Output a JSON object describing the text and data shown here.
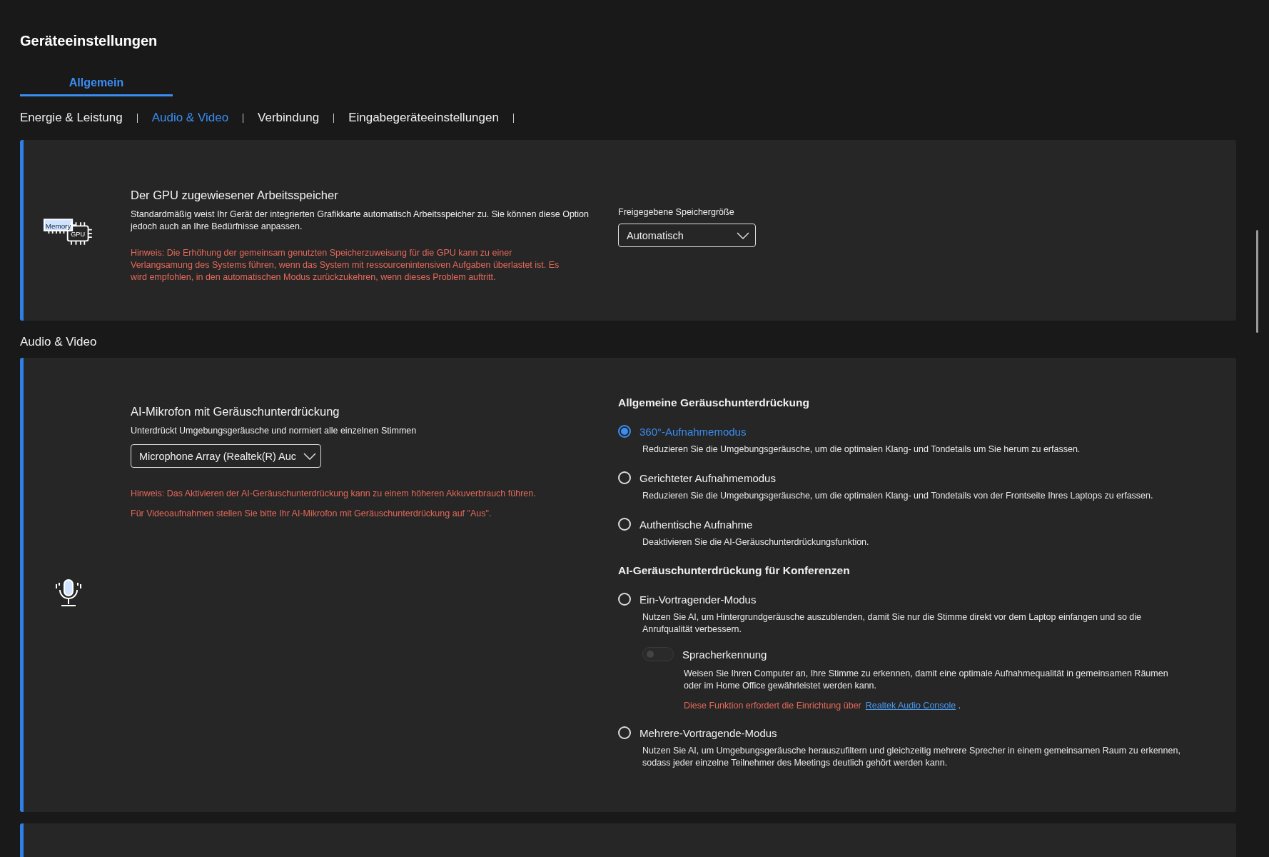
{
  "page_title": "Geräteeinstellungen",
  "tabs": [
    {
      "label": "Allgemein",
      "selected": true
    }
  ],
  "section_nav": [
    {
      "label": "Energie & Leistung",
      "selected": false
    },
    {
      "label": "Audio & Video",
      "selected": true
    },
    {
      "label": "Verbindung",
      "selected": false
    },
    {
      "label": "Eingabegeräteeinstellungen",
      "selected": false
    }
  ],
  "gpu_memory_card": {
    "icon_labels": [
      "Memory",
      "GPU"
    ],
    "title": "Der GPU zugewiesener Arbeitsspeicher",
    "description": "Standardmäßig weist Ihr Gerät der integrierten Grafikkarte automatisch Arbeitsspeicher zu. Sie können diese Option jedoch auch an Ihre Bedürfnisse anpassen.",
    "warning": "Hinweis: Die Erhöhung der gemeinsam genutzten Speicherzuweisung für die GPU kann zu einer Verlangsamung des Systems führen, wenn das System mit ressourcenintensiven Aufgaben überlastet ist. Es wird empfohlen, in den automatischen Modus zurückzukehren, wenn dieses Problem auftritt.",
    "setting_label": "Freigegebene Speichergröße",
    "dropdown_value": "Automatisch"
  },
  "section_heading": "Audio & Video",
  "ai_microphone_card": {
    "title": "AI-Mikrofon mit Geräuschunterdrückung",
    "description": "Unterdrückt Umgebungsgeräusche und normiert alle einzelnen Stimmen",
    "device_dropdown_value": "Microphone Array (Realtek(R) Auc",
    "warnings": [
      "Hinweis: Das Aktivieren der AI-Geräuschunterdrückung kann zu einem höheren Akkuverbrauch führen.",
      "Für Videoaufnahmen stellen Sie bitte Ihr AI-Mikrofon mit Geräuschunterdrückung auf \"Aus\"."
    ],
    "option_groups": [
      {
        "heading": "Allgemeine Geräuschunterdrückung",
        "options": [
          {
            "label": "360°-Aufnahmemodus",
            "description": "Reduzieren Sie die Umgebungsgeräusche, um die optimalen Klang- und Tondetails um Sie herum zu erfassen.",
            "selected": true
          },
          {
            "label": "Gerichteter Aufnahmemodus",
            "description": "Reduzieren Sie die Umgebungsgeräusche, um die optimalen Klang- und Tondetails von der Frontseite Ihres Laptops zu erfassen.",
            "selected": false
          },
          {
            "label": "Authentische Aufnahme",
            "description": "Deaktivieren Sie die AI-Geräuschunterdrückungsfunktion.",
            "selected": false
          }
        ]
      },
      {
        "heading": "AI-Geräuschunterdrückung für Konferenzen",
        "options": [
          {
            "label": "Ein-Vortragender-Modus",
            "description": "Nutzen Sie AI, um Hintergrundgeräusche auszublenden, damit Sie nur die Stimme direkt vor dem Laptop einfangen und so die Anrufqualität verbessern.",
            "selected": false,
            "sub_setting": {
              "label": "Spracherkennung",
              "on": false,
              "disabled": true,
              "description": "Weisen Sie Ihren Computer an, Ihre Stimme zu erkennen, damit eine optimale Aufnahmequalität in gemeinsamen Räumen oder im Home Office gewährleistet werden kann.",
              "note": "Diese Funktion erfordert die Einrichtung über",
              "link": "Realtek Audio Console",
              "note_end": "."
            }
          },
          {
            "label": "Mehrere-Vortragende-Modus",
            "description": "Nutzen Sie AI, um Umgebungsgeräusche herauszufiltern und gleichzeitig mehrere Sprecher in einem gemeinsamen Raum zu erkennen, sodass jeder einzelne Teilnehmer des Meetings deutlich gehört werden kann.",
            "selected": false
          }
        ]
      }
    ]
  }
}
